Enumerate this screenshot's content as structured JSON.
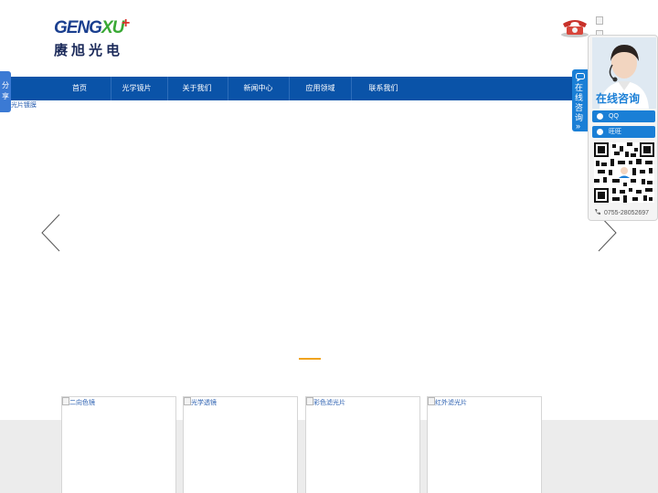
{
  "header": {
    "logo_en_main": "GENG",
    "logo_en_accent": "XU",
    "logo_plus": "+",
    "logo_cn": "赓旭光电"
  },
  "nav": {
    "items": [
      "首页",
      "光学镜片",
      "关于我们",
      "新闻中心",
      "应用领域",
      "联系我们"
    ]
  },
  "breadcrumb_text": "光片镀膜",
  "share_tab": "分享",
  "consult": {
    "tab_label": "在线咨询",
    "tab_arrow": "»",
    "panel_title": "在线咨询",
    "qq_label": "QQ",
    "wangwang_label": "旺旺",
    "phone": "0755-28052697"
  },
  "products": [
    {
      "alt": "二向色镜"
    },
    {
      "alt": "光学透镜"
    },
    {
      "alt": "彩色滤光片"
    },
    {
      "alt": "红外滤光片"
    }
  ],
  "colors": {
    "nav_bg": "#0a53a8",
    "accent_blue": "#1a7fd6",
    "indicator": "#f0a31e"
  },
  "icons": [
    "phone-icon",
    "arrow-left-icon",
    "arrow-right-icon",
    "qq-icon",
    "wangwang-icon",
    "qr-code",
    "phone-small-icon"
  ]
}
